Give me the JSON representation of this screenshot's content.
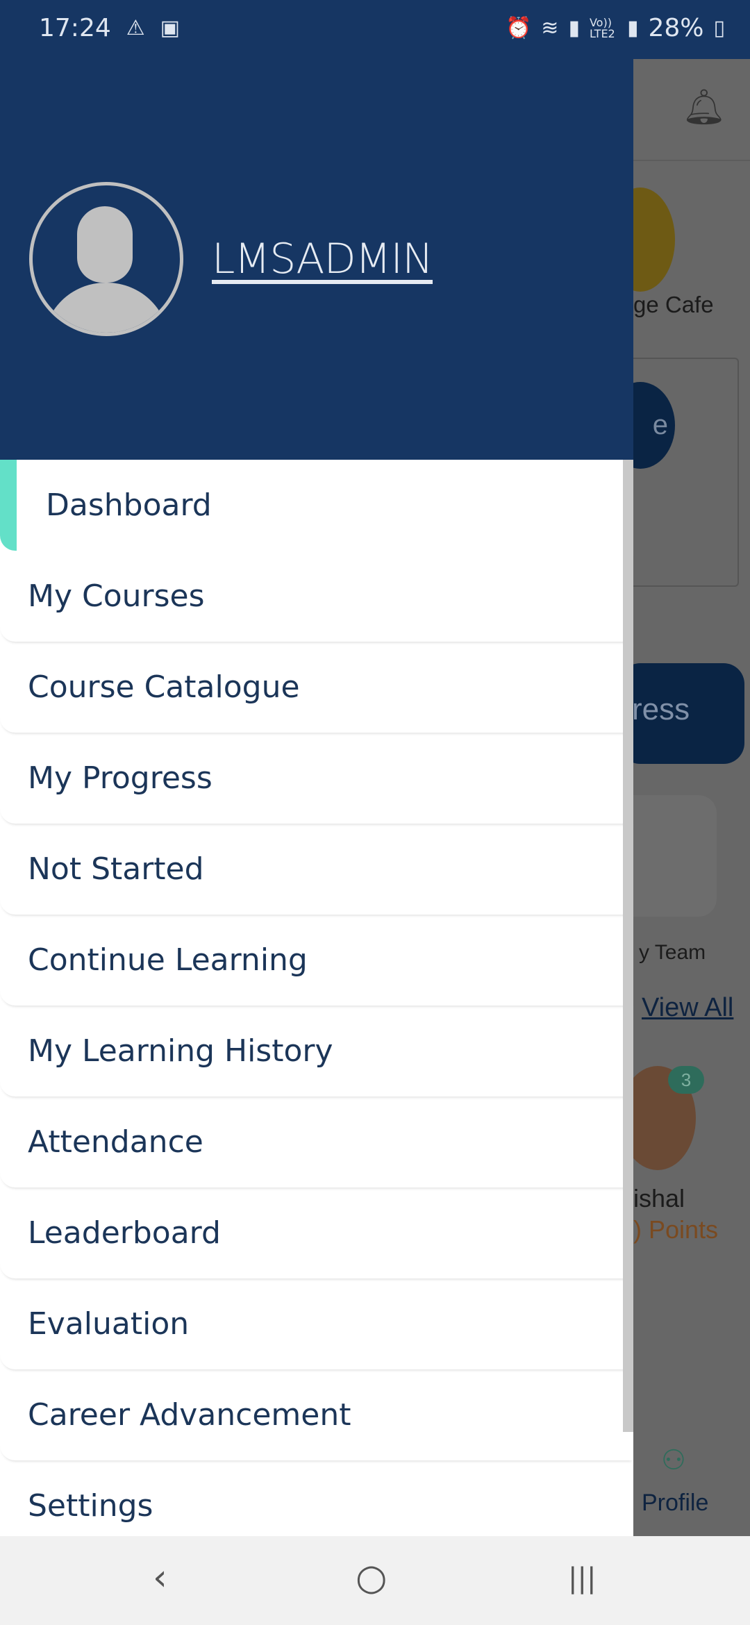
{
  "status_bar": {
    "time": "17:24",
    "icons": [
      "warning-icon",
      "image-icon",
      "alarm-icon",
      "wifi-icon",
      "signal-icon",
      "volte-lte2-icon",
      "signal-icon",
      "battery-charging-icon"
    ],
    "lte_label": "Vo)) LTE2",
    "battery": "28%"
  },
  "drawer": {
    "username": "LMSADMIN",
    "active_color": "#63e0c8",
    "header_color": "#163663",
    "items": [
      {
        "label": "Dashboard"
      },
      {
        "label": "My Courses"
      },
      {
        "label": "Course Catalogue"
      },
      {
        "label": "My Progress"
      },
      {
        "label": "Not Started"
      },
      {
        "label": "Continue Learning"
      },
      {
        "label": "My Learning History"
      },
      {
        "label": "Attendance"
      },
      {
        "label": "Leaderboard"
      },
      {
        "label": "Evaluation"
      },
      {
        "label": "Career Advancement"
      },
      {
        "label": "Settings"
      }
    ]
  },
  "background": {
    "cafe_label": "ge Cafe",
    "circle_label": "e",
    "progress_label": "ress",
    "team_label": "y Team",
    "view_all": "View All",
    "badge": "3",
    "person_name": "ishal",
    "points": ") Points",
    "profile_label": "Profile"
  },
  "nav": {
    "back": "‹",
    "home": "○",
    "recents": "|||"
  }
}
